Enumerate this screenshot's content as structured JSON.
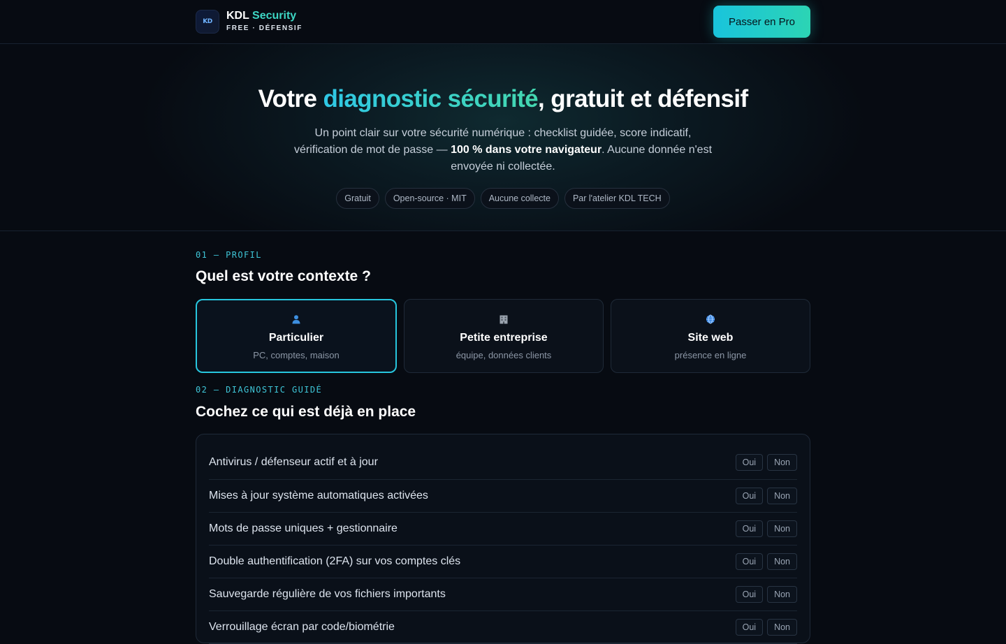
{
  "header": {
    "logo_text": "KD",
    "brand_name_part1": "KDL",
    "brand_name_part2": "Security",
    "brand_tagline": "FREE · DÉFENSIF",
    "cta_label": "Passer en Pro"
  },
  "hero": {
    "title_part1": "Votre ",
    "title_highlight": "diagnostic sécurité",
    "title_part2": ", gratuit et défensif",
    "subtitle_part1": "Un point clair sur votre sécurité numérique : checklist guidée, score indicatif, vérification de mot de passe — ",
    "subtitle_bold": "100 % dans votre navigateur",
    "subtitle_part2": ". Aucune donnée n'est envoyée ni collectée.",
    "badges": [
      "Gratuit",
      "Open-source · MIT",
      "Aucune collecte",
      "Par l'atelier KDL TECH"
    ]
  },
  "profile": {
    "label": "01 — PROFIL",
    "title": "Quel est votre contexte ?",
    "cards": [
      {
        "title": "Particulier",
        "desc": "PC, comptes, maison",
        "icon": "user-icon",
        "active": true
      },
      {
        "title": "Petite entreprise",
        "desc": "équipe, données clients",
        "icon": "building-icon",
        "active": false
      },
      {
        "title": "Site web",
        "desc": "présence en ligne",
        "icon": "globe-icon",
        "active": false
      }
    ]
  },
  "diagnostic": {
    "label": "02 — DIAGNOSTIC GUIDÉ",
    "title": "Cochez ce qui est déjà en place",
    "yes_label": "Oui",
    "no_label": "Non",
    "items": [
      "Antivirus / défenseur actif et à jour",
      "Mises à jour système automatiques activées",
      "Mots de passe uniques + gestionnaire",
      "Double authentification (2FA) sur vos comptes clés",
      "Sauvegarde régulière de vos fichiers importants",
      "Verrouillage écran par code/biométrie"
    ]
  },
  "colors": {
    "accent": "#27c6de",
    "accent_2": "#3dd6c4",
    "background": "#070b12"
  }
}
